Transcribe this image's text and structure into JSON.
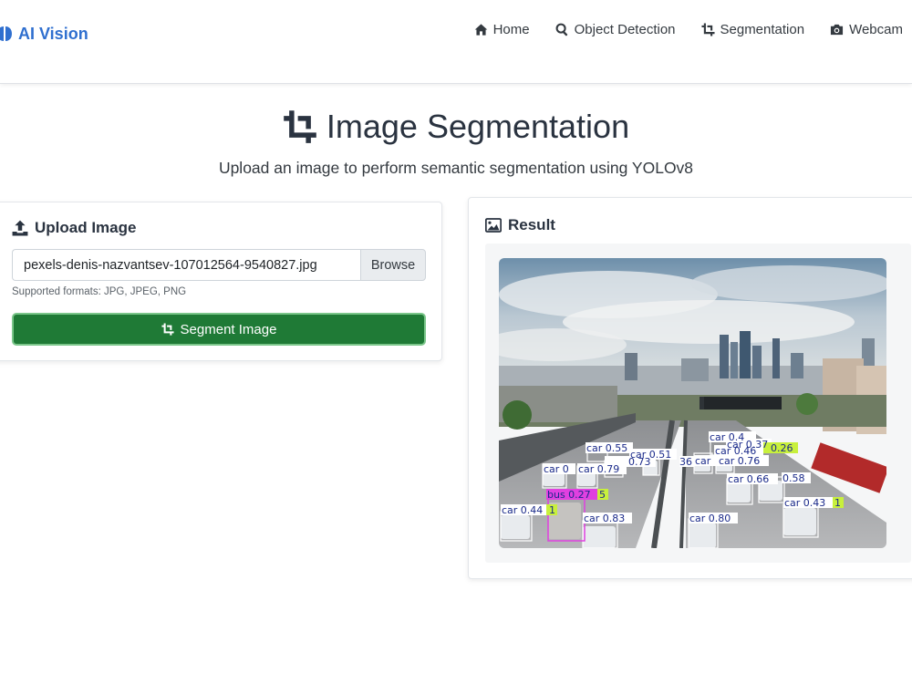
{
  "brand": {
    "name": "AI Vision",
    "icon": "brain-icon",
    "color": "#2f6fcf"
  },
  "nav": [
    {
      "label": "Home",
      "icon": "home-icon"
    },
    {
      "label": "Object Detection",
      "icon": "search-icon"
    },
    {
      "label": "Segmentation",
      "icon": "crop-icon"
    },
    {
      "label": "Webcam",
      "icon": "camera-icon"
    }
  ],
  "header": {
    "title": "Image Segmentation",
    "subtitle": "Upload an image to perform semantic segmentation using YOLOv8"
  },
  "upload": {
    "heading": "Upload Image",
    "file_name": "pexels-denis-nazvantsev-107012564-9540827.jpg",
    "browse_label": "Browse",
    "help": "Supported formats: JPG, JPEG, PNG",
    "submit_label": "Segment Image",
    "submit_color": "#1f7a36"
  },
  "result": {
    "heading": "Result",
    "detections": [
      {
        "label": "car 0.55",
        "class": "car"
      },
      {
        "label": "car 0.51",
        "class": "car"
      },
      {
        "label": "car 0.4",
        "class": "car"
      },
      {
        "label": "car 0.37",
        "class": "car"
      },
      {
        "label": "0.26",
        "class": "car"
      },
      {
        "label": "car 0.46",
        "class": "car"
      },
      {
        "label": "car 0",
        "class": "car"
      },
      {
        "label": "car 0.79",
        "class": "car"
      },
      {
        "label": "0.73",
        "class": "car"
      },
      {
        "label": "36",
        "class": "car"
      },
      {
        "label": "car",
        "class": "car"
      },
      {
        "label": "car 0.76",
        "class": "car"
      },
      {
        "label": "car 0.66",
        "class": "car"
      },
      {
        "label": "0.58",
        "class": "car"
      },
      {
        "label": "bus 0.27",
        "class": "bus"
      },
      {
        "label": "5",
        "class": "car"
      },
      {
        "label": "car 0.44",
        "class": "car"
      },
      {
        "label": "1",
        "class": "car"
      },
      {
        "label": "car 0.83",
        "class": "car"
      },
      {
        "label": "car 0.80",
        "class": "car"
      },
      {
        "label": "car 0.43",
        "class": "car"
      },
      {
        "label": "1",
        "class": "car"
      }
    ]
  }
}
